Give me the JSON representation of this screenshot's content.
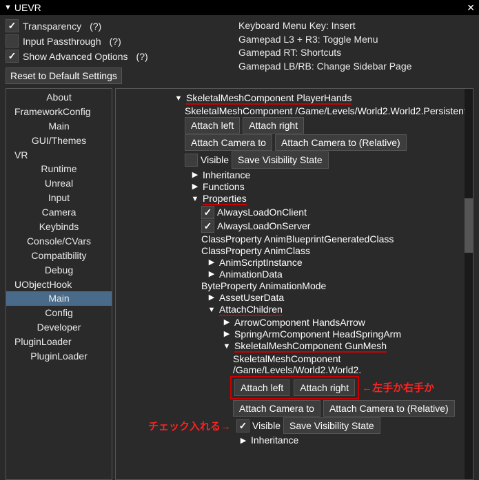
{
  "title": "UEVR",
  "top": {
    "transparency": "Transparency",
    "input_passthrough": "Input Passthrough",
    "show_advanced": "Show Advanced Options",
    "help": "(?)",
    "reset": "Reset to Default Settings",
    "kb_menu": "Keyboard Menu Key: Insert",
    "gp_l3r3": "Gamepad L3 + R3: Toggle Menu",
    "gp_rt": "Gamepad RT: Shortcuts",
    "gp_lbrb": "Gamepad LB/RB: Change Sidebar Page"
  },
  "sidebar": {
    "items": [
      "About",
      "FrameworkConfig",
      "Main",
      "GUI/Themes",
      "VR",
      "Runtime",
      "Unreal",
      "Input",
      "Camera",
      "Keybinds",
      "Console/CVars",
      "Compatibility",
      "Debug",
      "UObjectHook",
      "Main",
      "Config",
      "Developer",
      "PluginLoader",
      "PluginLoader"
    ]
  },
  "c": {
    "header": "SkeletalMeshComponent PlayerHands",
    "path": "SkeletalMeshComponent /Game/Levels/World2.World2.Persistent",
    "attach_left": "Attach left",
    "attach_right": "Attach right",
    "attach_cam": "Attach Camera to",
    "attach_cam_rel": "Attach Camera to (Relative)",
    "visible": "Visible",
    "save_vis": "Save Visibility State",
    "inheritance": "Inheritance",
    "functions": "Functions",
    "properties": "Properties",
    "always_client": "AlwaysLoadOnClient",
    "always_server": "AlwaysLoadOnServer",
    "class_anim_bp": "ClassProperty AnimBlueprintGeneratedClass",
    "class_anim": "ClassProperty AnimClass",
    "anim_script": "AnimScriptInstance",
    "anim_data": "AnimationData",
    "byte_anim": "ByteProperty AnimationMode",
    "asset_user": "AssetUserData",
    "attach_children": "AttachChildren",
    "arrow_comp": "ArrowComponent HandsArrow",
    "spring_arm": "SpringArmComponent HeadSpringArm",
    "gun_mesh": "SkeletalMeshComponent GunMesh",
    "gun_path": "SkeletalMeshComponent /Game/Levels/World2.World2.",
    "ann_lr": "←左手か右手か",
    "ann_chk": "チェック入れる→"
  }
}
